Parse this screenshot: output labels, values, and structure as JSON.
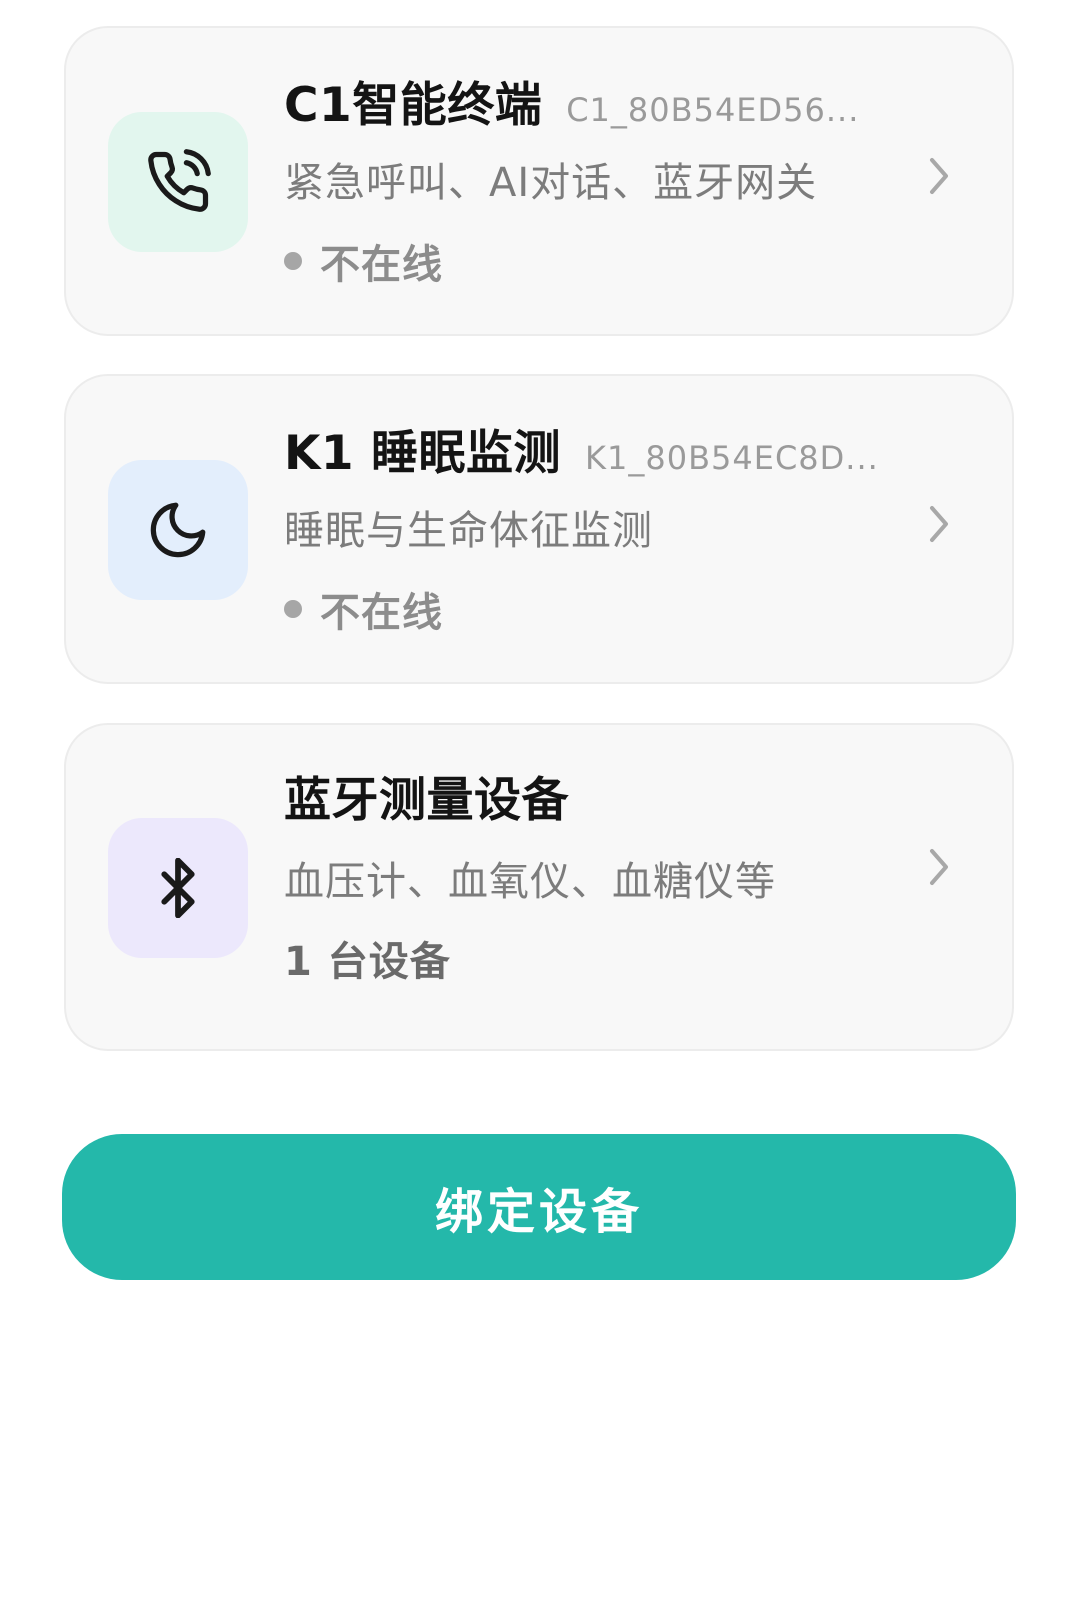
{
  "devices": [
    {
      "name": "C1智能终端",
      "device_id": "C1_80B54ED56...",
      "description": "紧急呼叫、AI对话、蓝牙网关",
      "status": "不在线",
      "icon": "phone-call-icon",
      "tile_color": "#e2f6ee"
    },
    {
      "name": "K1 睡眠监测",
      "device_id": "K1_80B54EC8D...",
      "description": "睡眠与生命体征监测",
      "status": "不在线",
      "icon": "moon-icon",
      "tile_color": "#e3eefc"
    },
    {
      "name": "蓝牙测量设备",
      "description": "血压计、血氧仪、血糖仪等",
      "count_text": "1 台设备",
      "icon": "bluetooth-icon",
      "tile_color": "#ece8fc"
    }
  ],
  "bind_button": {
    "label": "绑定设备",
    "color": "#24b8aa"
  },
  "status_dot_color": "#a6a6a6"
}
